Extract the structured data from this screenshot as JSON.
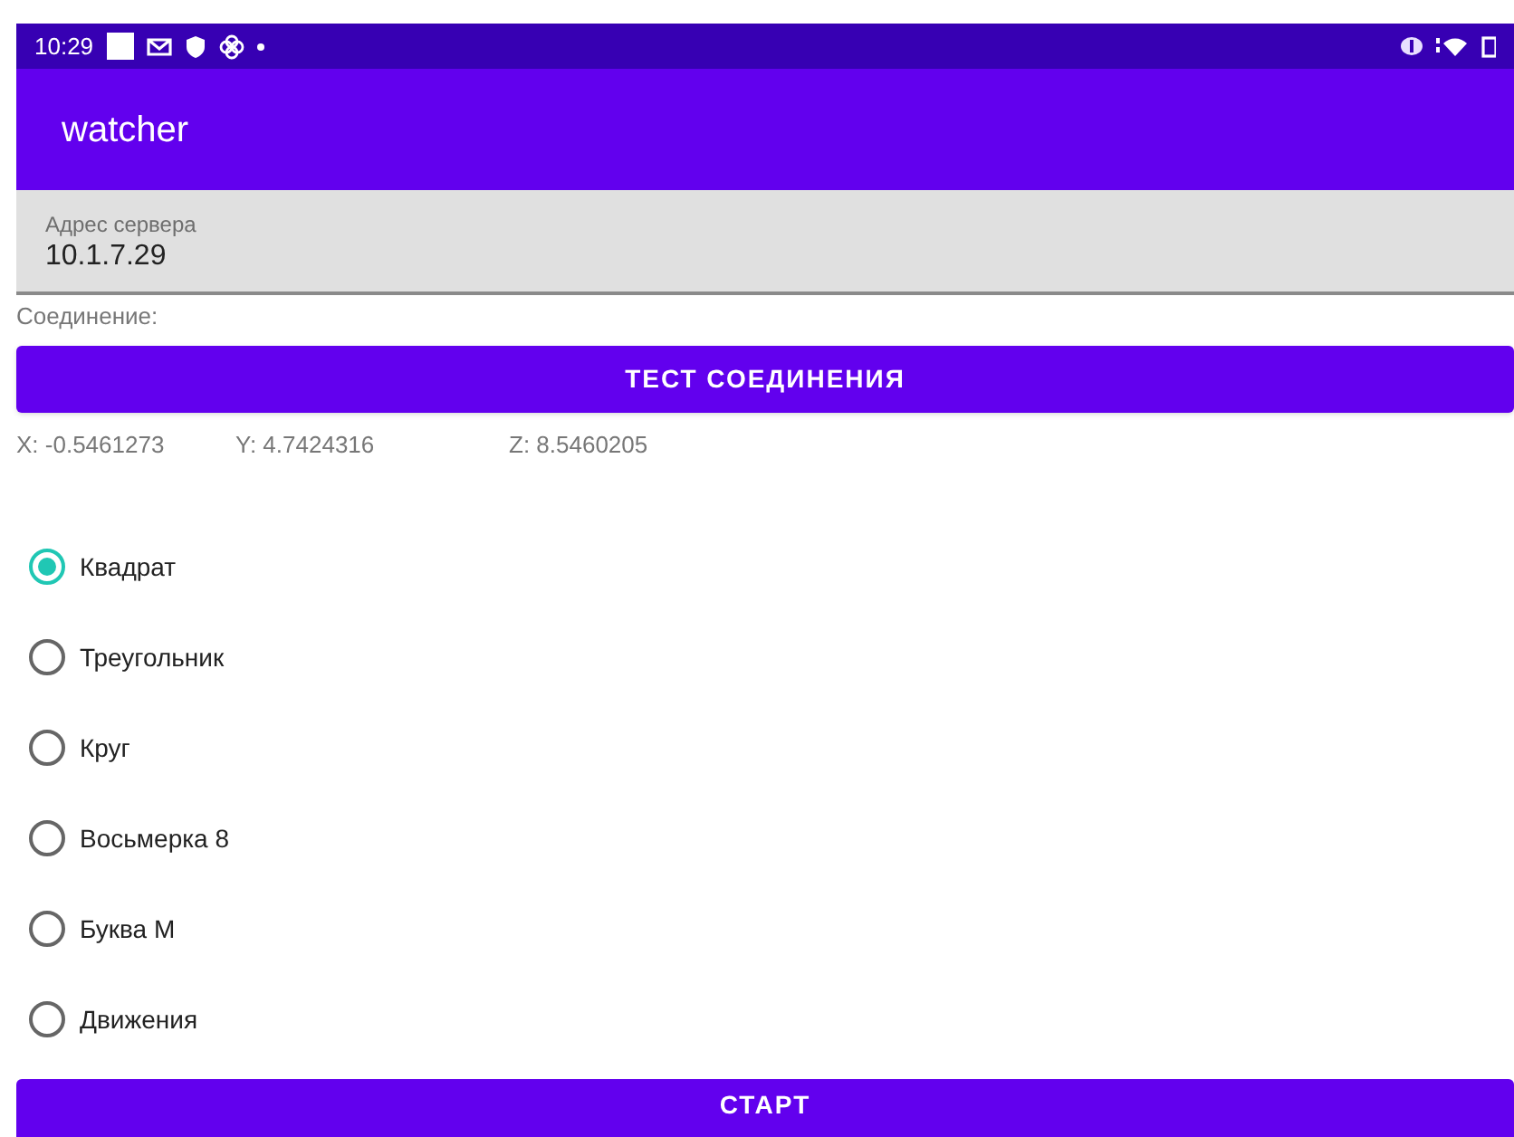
{
  "status_bar": {
    "time": "10:29"
  },
  "app_bar": {
    "title": "watcher"
  },
  "server_field": {
    "label": "Адрес сервера",
    "value": "10.1.7.29"
  },
  "connection_label": "Соединение:",
  "test_button": "ТЕСТ СОЕДИНЕНИЯ",
  "accelerometer": [
    "X: -0.5461273",
    "Y: 4.7424316",
    "Z: 8.5460205"
  ],
  "shapes": [
    {
      "label": "Квадрат",
      "selected": true
    },
    {
      "label": "Треугольник",
      "selected": false
    },
    {
      "label": "Круг",
      "selected": false
    },
    {
      "label": "Восьмерка 8",
      "selected": false
    },
    {
      "label": "Буква М",
      "selected": false
    },
    {
      "label": "Движения",
      "selected": false
    }
  ],
  "start_button": "СТАРТ"
}
